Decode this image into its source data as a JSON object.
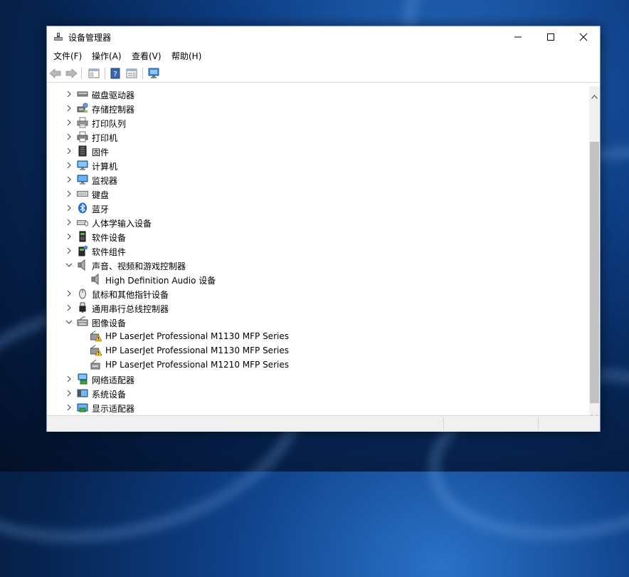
{
  "window": {
    "title": "设备管理器"
  },
  "menu": [
    "文件(F)",
    "操作(A)",
    "查看(V)",
    "帮助(H)"
  ],
  "tree": [
    {
      "label": "磁盘驱动器",
      "icon": "disk-drive-icon",
      "expanded": false,
      "level": 0
    },
    {
      "label": "存储控制器",
      "icon": "storage-controller-icon",
      "expanded": false,
      "level": 0
    },
    {
      "label": "打印队列",
      "icon": "print-queue-icon",
      "expanded": false,
      "level": 0
    },
    {
      "label": "打印机",
      "icon": "printer-icon",
      "expanded": false,
      "level": 0
    },
    {
      "label": "固件",
      "icon": "firmware-icon",
      "expanded": false,
      "level": 0
    },
    {
      "label": "计算机",
      "icon": "computer-icon",
      "expanded": false,
      "level": 0
    },
    {
      "label": "监视器",
      "icon": "monitor-icon",
      "expanded": false,
      "level": 0
    },
    {
      "label": "键盘",
      "icon": "keyboard-icon",
      "expanded": false,
      "level": 0
    },
    {
      "label": "蓝牙",
      "icon": "bluetooth-icon",
      "expanded": false,
      "level": 0
    },
    {
      "label": "人体学输入设备",
      "icon": "hid-icon",
      "expanded": false,
      "level": 0
    },
    {
      "label": "软件设备",
      "icon": "software-device-icon",
      "expanded": false,
      "level": 0
    },
    {
      "label": "软件组件",
      "icon": "software-component-icon",
      "expanded": false,
      "level": 0
    },
    {
      "label": "声音、视频和游戏控制器",
      "icon": "speaker-icon",
      "expanded": true,
      "level": 0
    },
    {
      "label": "High Definition Audio 设备",
      "icon": "speaker-icon",
      "level": 1
    },
    {
      "label": "鼠标和其他指针设备",
      "icon": "mouse-icon",
      "expanded": false,
      "level": 0
    },
    {
      "label": "通用串行总线控制器",
      "icon": "usb-icon",
      "expanded": false,
      "level": 0
    },
    {
      "label": "图像设备",
      "icon": "imaging-device-icon",
      "expanded": true,
      "level": 0
    },
    {
      "label": "HP LaserJet Professional M1130 MFP Series",
      "icon": "scanner-warning-icon",
      "level": 1
    },
    {
      "label": "HP LaserJet Professional M1130 MFP Series",
      "icon": "scanner-warning-icon",
      "level": 1
    },
    {
      "label": "HP LaserJet Professional M1210 MFP Series",
      "icon": "scanner-icon",
      "level": 1
    },
    {
      "label": "网络适配器",
      "icon": "network-adapter-icon",
      "expanded": false,
      "level": 0
    },
    {
      "label": "系统设备",
      "icon": "system-device-icon",
      "expanded": false,
      "level": 0
    },
    {
      "label": "显示适配器",
      "icon": "display-adapter-icon",
      "expanded": false,
      "level": 0
    }
  ]
}
